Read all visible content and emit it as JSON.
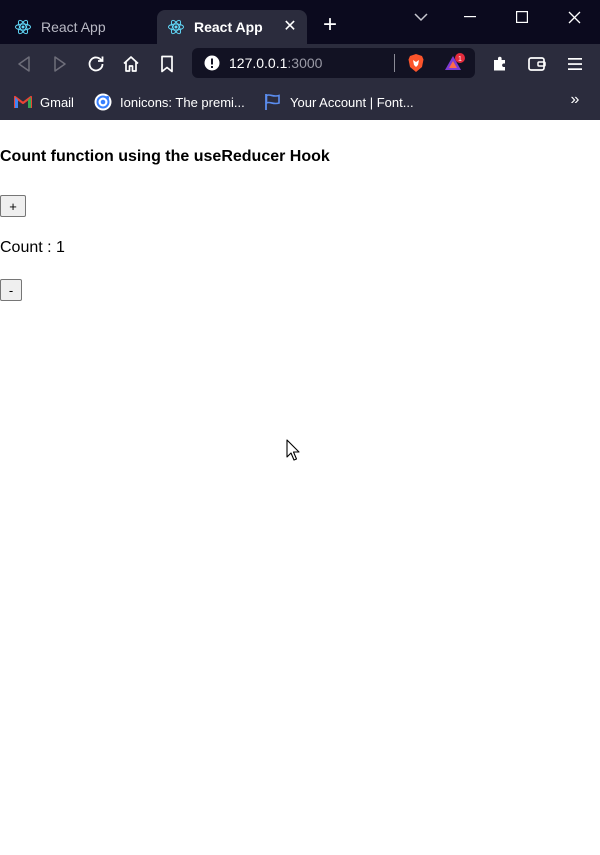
{
  "tabs": [
    {
      "title": "React App",
      "active": false
    },
    {
      "title": "React App",
      "active": true
    }
  ],
  "address_bar": {
    "host": "127.0.0.1",
    "port": ":3000"
  },
  "rewards_badge": "1",
  "bookmarks": [
    {
      "label": "Gmail",
      "icon": "gmail-icon"
    },
    {
      "label": "Ionicons: The premi...",
      "icon": "ionicons-icon"
    },
    {
      "label": "Your Account | Font...",
      "icon": "flag-icon"
    }
  ],
  "page": {
    "heading": "Count function using the useReducer Hook",
    "increment_label": "+",
    "count_text": "Count : 1",
    "decrement_label": "-"
  },
  "colors": {
    "tabstrip": "#0b0a1e",
    "toolbar": "#2b2c3d",
    "omnibox": "#121223",
    "brave_orange": "#fb542b",
    "badge_red": "#e52b3c"
  }
}
